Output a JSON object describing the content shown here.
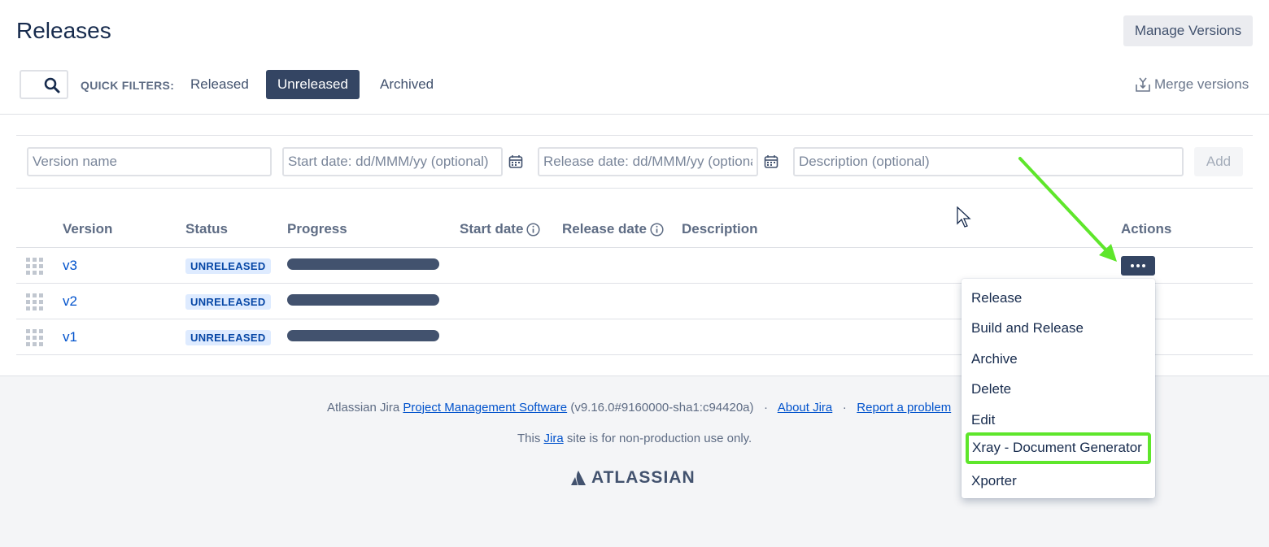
{
  "header": {
    "title": "Releases",
    "manage_label": "Manage Versions"
  },
  "filters": {
    "label": "QUICK FILTERS:",
    "items": [
      "Released",
      "Unreleased",
      "Archived"
    ],
    "active": "Unreleased",
    "merge_label": "Merge versions"
  },
  "form": {
    "version_placeholder": "Version name",
    "start_placeholder": "Start date: dd/MMM/yy (optional)",
    "release_placeholder": "Release date: dd/MMM/yy (optional)",
    "description_placeholder": "Description (optional)",
    "add_label": "Add"
  },
  "table": {
    "columns": [
      "Version",
      "Status",
      "Progress",
      "Start date",
      "Release date",
      "Description",
      "Actions"
    ],
    "rows": [
      {
        "version": "v3",
        "status": "UNRELEASED"
      },
      {
        "version": "v2",
        "status": "UNRELEASED"
      },
      {
        "version": "v1",
        "status": "UNRELEASED"
      }
    ]
  },
  "actions_menu": {
    "items": [
      "Release",
      "Build and Release",
      "Archive",
      "Delete",
      "Edit",
      "Xray - Document Generator",
      "Xporter"
    ],
    "highlighted": "Xray - Document Generator"
  },
  "footer": {
    "prefix": "Atlassian Jira",
    "pm_link": "Project Management Software",
    "version": "(v9.16.0#9160000-sha1:c94420a)",
    "dot": "·",
    "about_link": "About Jira",
    "report_link": "Report a problem",
    "notice_pre": "This",
    "notice_link": "Jira",
    "notice_post": "site is for non-production use only.",
    "logo_text": "ATLASSIAN"
  },
  "colors": {
    "accent": "#344563",
    "link": "#0052cc",
    "highlight": "#5ee62b"
  }
}
